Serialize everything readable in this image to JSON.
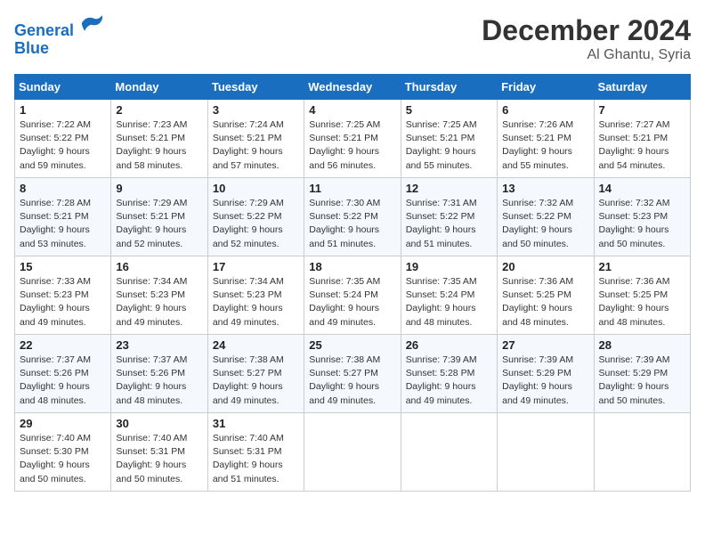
{
  "header": {
    "logo_line1": "General",
    "logo_line2": "Blue",
    "month": "December 2024",
    "location": "Al Ghantu, Syria"
  },
  "weekdays": [
    "Sunday",
    "Monday",
    "Tuesday",
    "Wednesday",
    "Thursday",
    "Friday",
    "Saturday"
  ],
  "weeks": [
    [
      {
        "day": "1",
        "sunrise": "Sunrise: 7:22 AM",
        "sunset": "Sunset: 5:22 PM",
        "daylight": "Daylight: 9 hours and 59 minutes."
      },
      {
        "day": "2",
        "sunrise": "Sunrise: 7:23 AM",
        "sunset": "Sunset: 5:21 PM",
        "daylight": "Daylight: 9 hours and 58 minutes."
      },
      {
        "day": "3",
        "sunrise": "Sunrise: 7:24 AM",
        "sunset": "Sunset: 5:21 PM",
        "daylight": "Daylight: 9 hours and 57 minutes."
      },
      {
        "day": "4",
        "sunrise": "Sunrise: 7:25 AM",
        "sunset": "Sunset: 5:21 PM",
        "daylight": "Daylight: 9 hours and 56 minutes."
      },
      {
        "day": "5",
        "sunrise": "Sunrise: 7:25 AM",
        "sunset": "Sunset: 5:21 PM",
        "daylight": "Daylight: 9 hours and 55 minutes."
      },
      {
        "day": "6",
        "sunrise": "Sunrise: 7:26 AM",
        "sunset": "Sunset: 5:21 PM",
        "daylight": "Daylight: 9 hours and 55 minutes."
      },
      {
        "day": "7",
        "sunrise": "Sunrise: 7:27 AM",
        "sunset": "Sunset: 5:21 PM",
        "daylight": "Daylight: 9 hours and 54 minutes."
      }
    ],
    [
      {
        "day": "8",
        "sunrise": "Sunrise: 7:28 AM",
        "sunset": "Sunset: 5:21 PM",
        "daylight": "Daylight: 9 hours and 53 minutes."
      },
      {
        "day": "9",
        "sunrise": "Sunrise: 7:29 AM",
        "sunset": "Sunset: 5:21 PM",
        "daylight": "Daylight: 9 hours and 52 minutes."
      },
      {
        "day": "10",
        "sunrise": "Sunrise: 7:29 AM",
        "sunset": "Sunset: 5:22 PM",
        "daylight": "Daylight: 9 hours and 52 minutes."
      },
      {
        "day": "11",
        "sunrise": "Sunrise: 7:30 AM",
        "sunset": "Sunset: 5:22 PM",
        "daylight": "Daylight: 9 hours and 51 minutes."
      },
      {
        "day": "12",
        "sunrise": "Sunrise: 7:31 AM",
        "sunset": "Sunset: 5:22 PM",
        "daylight": "Daylight: 9 hours and 51 minutes."
      },
      {
        "day": "13",
        "sunrise": "Sunrise: 7:32 AM",
        "sunset": "Sunset: 5:22 PM",
        "daylight": "Daylight: 9 hours and 50 minutes."
      },
      {
        "day": "14",
        "sunrise": "Sunrise: 7:32 AM",
        "sunset": "Sunset: 5:23 PM",
        "daylight": "Daylight: 9 hours and 50 minutes."
      }
    ],
    [
      {
        "day": "15",
        "sunrise": "Sunrise: 7:33 AM",
        "sunset": "Sunset: 5:23 PM",
        "daylight": "Daylight: 9 hours and 49 minutes."
      },
      {
        "day": "16",
        "sunrise": "Sunrise: 7:34 AM",
        "sunset": "Sunset: 5:23 PM",
        "daylight": "Daylight: 9 hours and 49 minutes."
      },
      {
        "day": "17",
        "sunrise": "Sunrise: 7:34 AM",
        "sunset": "Sunset: 5:23 PM",
        "daylight": "Daylight: 9 hours and 49 minutes."
      },
      {
        "day": "18",
        "sunrise": "Sunrise: 7:35 AM",
        "sunset": "Sunset: 5:24 PM",
        "daylight": "Daylight: 9 hours and 49 minutes."
      },
      {
        "day": "19",
        "sunrise": "Sunrise: 7:35 AM",
        "sunset": "Sunset: 5:24 PM",
        "daylight": "Daylight: 9 hours and 48 minutes."
      },
      {
        "day": "20",
        "sunrise": "Sunrise: 7:36 AM",
        "sunset": "Sunset: 5:25 PM",
        "daylight": "Daylight: 9 hours and 48 minutes."
      },
      {
        "day": "21",
        "sunrise": "Sunrise: 7:36 AM",
        "sunset": "Sunset: 5:25 PM",
        "daylight": "Daylight: 9 hours and 48 minutes."
      }
    ],
    [
      {
        "day": "22",
        "sunrise": "Sunrise: 7:37 AM",
        "sunset": "Sunset: 5:26 PM",
        "daylight": "Daylight: 9 hours and 48 minutes."
      },
      {
        "day": "23",
        "sunrise": "Sunrise: 7:37 AM",
        "sunset": "Sunset: 5:26 PM",
        "daylight": "Daylight: 9 hours and 48 minutes."
      },
      {
        "day": "24",
        "sunrise": "Sunrise: 7:38 AM",
        "sunset": "Sunset: 5:27 PM",
        "daylight": "Daylight: 9 hours and 49 minutes."
      },
      {
        "day": "25",
        "sunrise": "Sunrise: 7:38 AM",
        "sunset": "Sunset: 5:27 PM",
        "daylight": "Daylight: 9 hours and 49 minutes."
      },
      {
        "day": "26",
        "sunrise": "Sunrise: 7:39 AM",
        "sunset": "Sunset: 5:28 PM",
        "daylight": "Daylight: 9 hours and 49 minutes."
      },
      {
        "day": "27",
        "sunrise": "Sunrise: 7:39 AM",
        "sunset": "Sunset: 5:29 PM",
        "daylight": "Daylight: 9 hours and 49 minutes."
      },
      {
        "day": "28",
        "sunrise": "Sunrise: 7:39 AM",
        "sunset": "Sunset: 5:29 PM",
        "daylight": "Daylight: 9 hours and 50 minutes."
      }
    ],
    [
      {
        "day": "29",
        "sunrise": "Sunrise: 7:40 AM",
        "sunset": "Sunset: 5:30 PM",
        "daylight": "Daylight: 9 hours and 50 minutes."
      },
      {
        "day": "30",
        "sunrise": "Sunrise: 7:40 AM",
        "sunset": "Sunset: 5:31 PM",
        "daylight": "Daylight: 9 hours and 50 minutes."
      },
      {
        "day": "31",
        "sunrise": "Sunrise: 7:40 AM",
        "sunset": "Sunset: 5:31 PM",
        "daylight": "Daylight: 9 hours and 51 minutes."
      },
      null,
      null,
      null,
      null
    ]
  ]
}
